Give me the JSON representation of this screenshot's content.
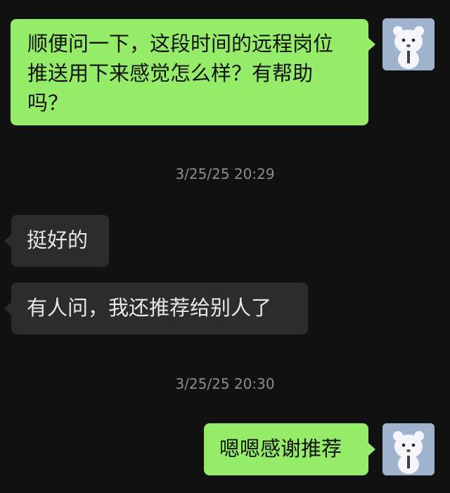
{
  "messages": [
    {
      "side": "out",
      "text": "顺便问一下，这段时间的远程岗位推送用下来感觉怎么样？有帮助吗？"
    },
    {
      "timestamp": "3/25/25 20:29"
    },
    {
      "side": "in",
      "text": "挺好的"
    },
    {
      "side": "in",
      "text": "有人问，我还推荐给别人了"
    },
    {
      "timestamp": "3/25/25 20:30"
    },
    {
      "side": "out",
      "text": "嗯嗯感谢推荐"
    }
  ],
  "avatar_icon": "white-bear-avatar-icon",
  "colors": {
    "background": "#111111",
    "outgoing_bubble": "#95EC69",
    "incoming_bubble": "#2C2C2C",
    "timestamp": "#8C8C8C"
  }
}
